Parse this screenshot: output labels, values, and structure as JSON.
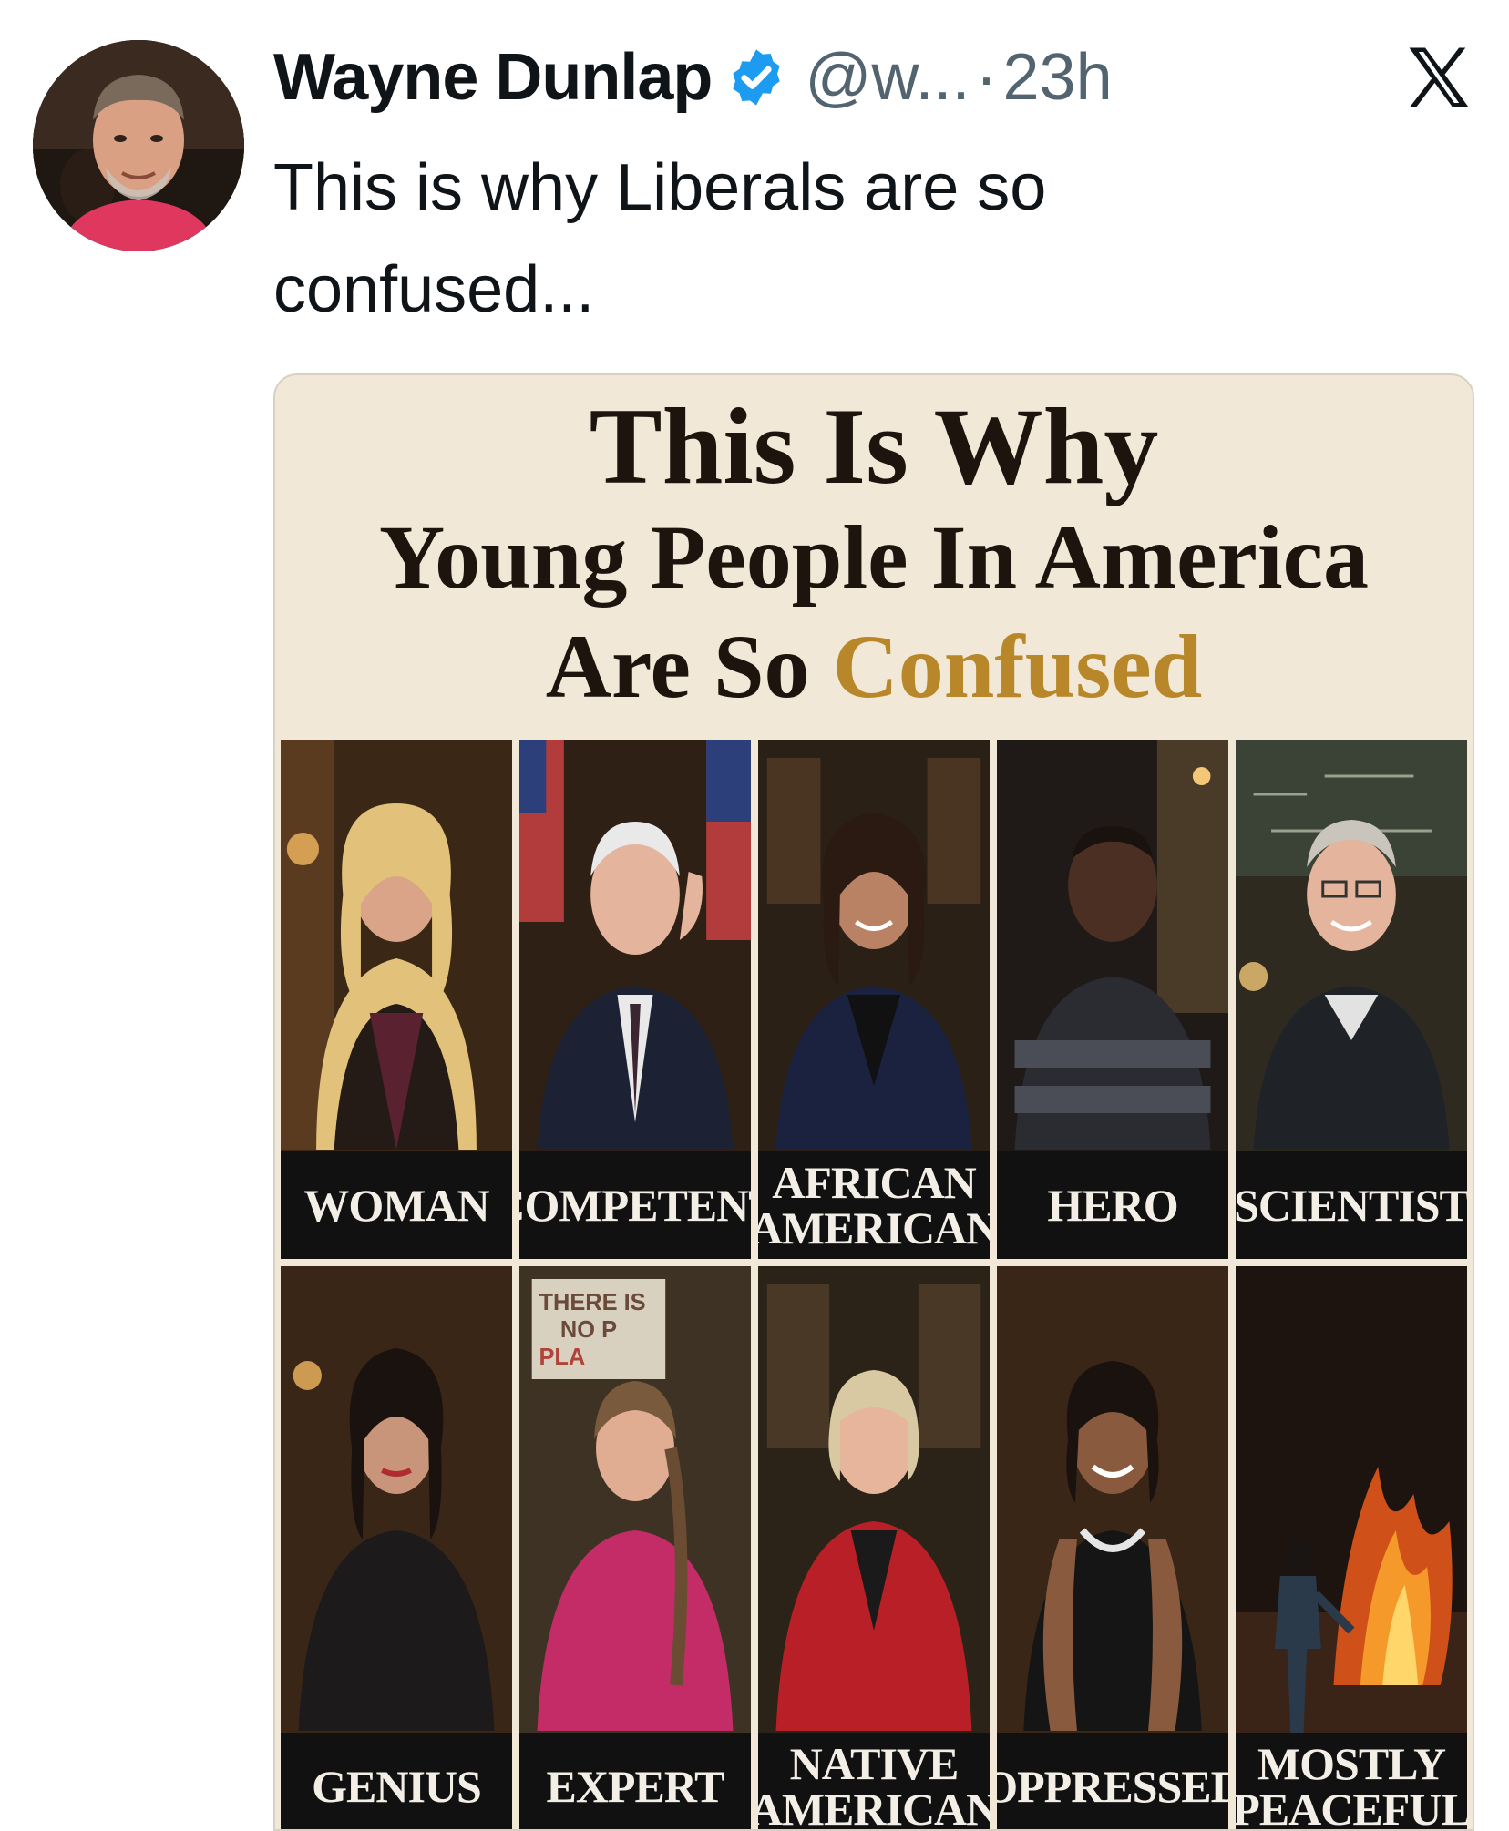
{
  "post": {
    "author_name": "Wayne Dunlap",
    "handle": "@w...",
    "separator": "·",
    "time": "23h",
    "text": "This is why Liberals are so confused..."
  },
  "icons": {
    "avatar": "avatar-photo",
    "verified": "verified-badge-icon",
    "platform": "x-logo-icon"
  },
  "media": {
    "title_line1": "This Is Why",
    "title_line2": "Young People In America",
    "title_line3_a": "Are So ",
    "title_line3_b": "Confused",
    "panels": [
      {
        "caption": "WOMAN"
      },
      {
        "caption": "COMPETENT"
      },
      {
        "caption": "AFRICAN\nAMERICAN"
      },
      {
        "caption": "HERO"
      },
      {
        "caption": "SCIENTIST"
      },
      {
        "caption": "GENIUS"
      },
      {
        "caption": "EXPERT"
      },
      {
        "caption": "NATIVE\nAMERICAN"
      },
      {
        "caption": "OPPRESSED"
      },
      {
        "caption": "MOSTLY\nPEACEFUL"
      }
    ],
    "sign_text": "THERE IS NO PLA"
  },
  "colors": {
    "verified_blue": "#1d9bf0",
    "accent_gold": "#b8872a",
    "secondary_text": "#536471",
    "background_cream": "#f1e8d7"
  }
}
